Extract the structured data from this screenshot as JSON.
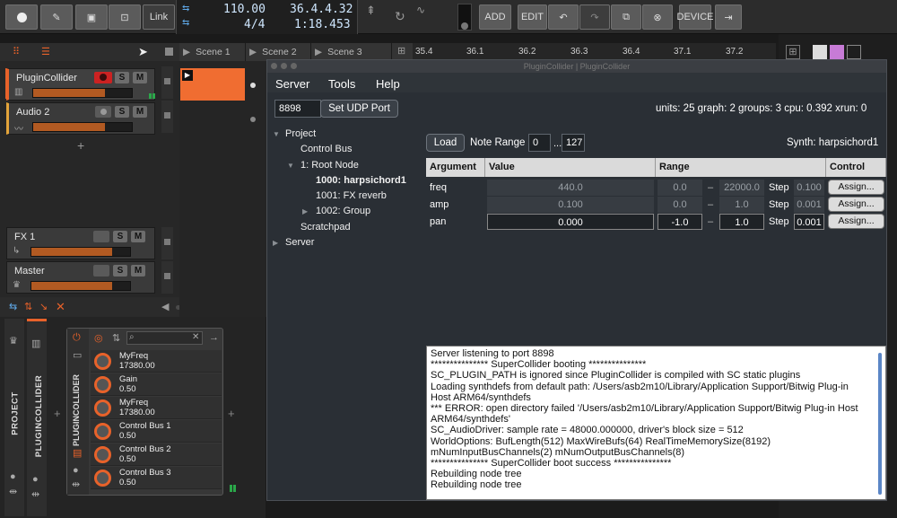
{
  "toolbar": {
    "link_label": "Link",
    "tempo": "110.00",
    "time_signature": "4/4",
    "position_bars": "36.4.4.32",
    "position_time": "1:18.453",
    "add_label": "ADD",
    "edit_label": "EDIT",
    "device_label": "DEVICE"
  },
  "tracks": [
    {
      "name": "PluginCollider",
      "s": "S",
      "m": "M",
      "color": "#e8622a"
    },
    {
      "name": "Audio 2",
      "s": "S",
      "m": "M",
      "color": "#e3a43a"
    }
  ],
  "fx_tracks": [
    {
      "name": "FX 1",
      "s": "S",
      "m": "M"
    },
    {
      "name": "Master",
      "s": "S",
      "m": "M"
    }
  ],
  "scenes": [
    "Scene 1",
    "Scene 2",
    "Scene 3"
  ],
  "ruler": [
    "35.4",
    "36.1",
    "36.2",
    "36.3",
    "36.4",
    "37.1",
    "37.2"
  ],
  "device_panel": {
    "project_label": "PROJECT",
    "plugin_label": "PLUGINCOLLIDER",
    "params": [
      {
        "name": "MyFreq",
        "value": "17380.00"
      },
      {
        "name": "Gain",
        "value": "0.50"
      },
      {
        "name": "MyFreq",
        "value": "17380.00"
      },
      {
        "name": "Control Bus 1",
        "value": "0.50"
      },
      {
        "name": "Control Bus 2",
        "value": "0.50"
      },
      {
        "name": "Control Bus 3",
        "value": "0.50"
      }
    ]
  },
  "plugin_window": {
    "title": "PluginCollider | PluginCollider",
    "menu": [
      "Server",
      "Tools",
      "Help"
    ],
    "port": "8898",
    "set_port_label": "Set UDP Port",
    "status": "units: 25 graph: 2 groups: 3 cpu: 0.392 xrun: 0",
    "load_label": "Load",
    "note_range_label": "Note Range",
    "note_min": "0",
    "note_sep": "...",
    "note_max": "127",
    "synth_label": "Synth: harpsichord1",
    "tree": [
      "Project",
      "Control Bus",
      "1: Root Node",
      "1000: harpsichord1",
      "1001: FX reverb",
      "1002: Group",
      "Scratchpad",
      "Server"
    ],
    "table_headers": [
      "Argument",
      "Value",
      "Range",
      "Control Bus"
    ],
    "step_label": "Step",
    "dash": "–",
    "args": [
      {
        "name": "freq",
        "value": "440.0",
        "min": "0.0",
        "max": "22000.0",
        "step": "0.100",
        "assign": "Assign..."
      },
      {
        "name": "amp",
        "value": "0.100",
        "min": "0.0",
        "max": "1.0",
        "step": "0.001",
        "assign": "Assign..."
      },
      {
        "name": "pan",
        "value": "0.000",
        "min": "-1.0",
        "max": "1.0",
        "step": "0.001",
        "assign": "Assign..."
      }
    ],
    "console": [
      "Server listening to port 8898",
      "*************** SuperCollider booting ***************",
      "SC_PLUGIN_PATH is ignored since PluginCollider is compiled with SC static plugins",
      "Loading synthdefs from default path: /Users/asb2m10/Library/Application Support/Bitwig Plug-in",
      "Host ARM64/synthdefs",
      "*** ERROR: open directory failed '/Users/asb2m10/Library/Application Support/Bitwig Plug-in Host",
      "ARM64/synthdefs'",
      "SC_AudioDriver: sample rate = 48000.000000, driver's block size = 512",
      "WorldOptions: BufLength(512) MaxWireBufs(64) RealTimeMemorySize(8192)",
      "mNumInputBusChannels(2) mNumOutputBusChannels(8)",
      "*************** SuperCollider boot success ***************",
      "Rebuilding node tree",
      "Rebuilding node tree"
    ]
  }
}
